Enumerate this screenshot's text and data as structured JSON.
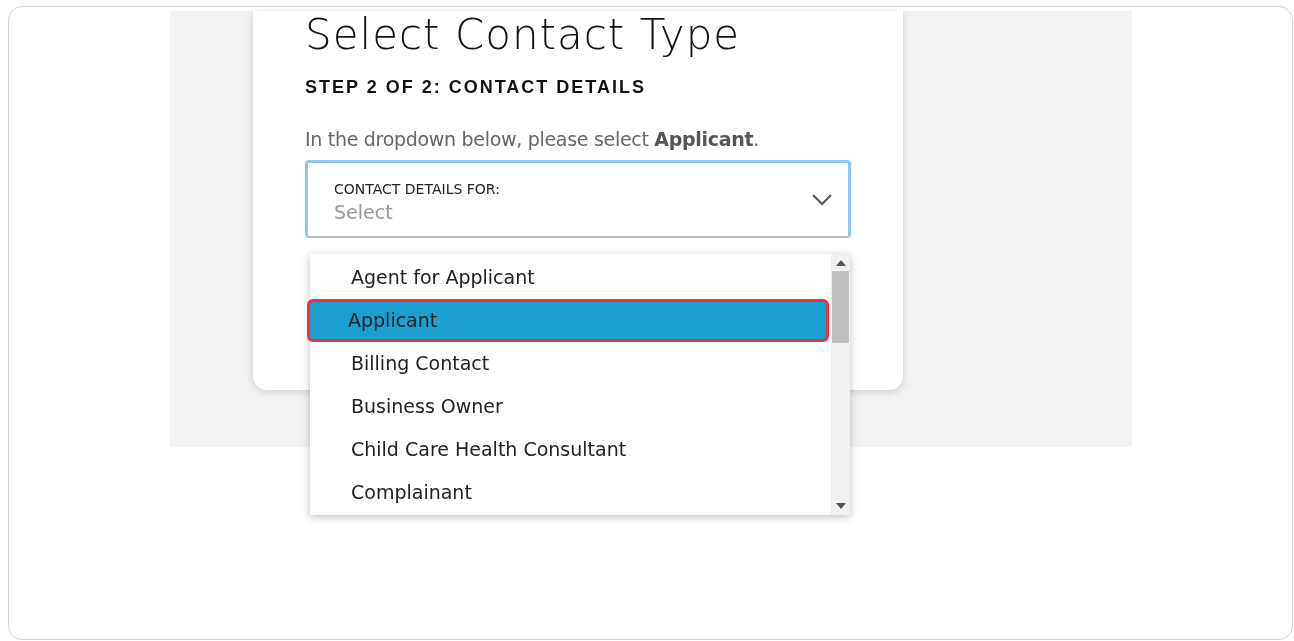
{
  "title": "Select Contact Type",
  "step_heading": "STEP 2 OF 2: CONTACT DETAILS",
  "instruction": "In the dropdown below, please select **Applicant**.",
  "select": {
    "label": "CONTACT DETAILS FOR:",
    "placeholder": "Select"
  },
  "options": [
    {
      "label": "Agent for Applicant",
      "selected": false
    },
    {
      "label": "Applicant",
      "selected": true
    },
    {
      "label": "Billing Contact",
      "selected": false
    },
    {
      "label": "Business Owner",
      "selected": false
    },
    {
      "label": "Child Care Health Consultant",
      "selected": false
    },
    {
      "label": "Complainant",
      "selected": false
    }
  ]
}
